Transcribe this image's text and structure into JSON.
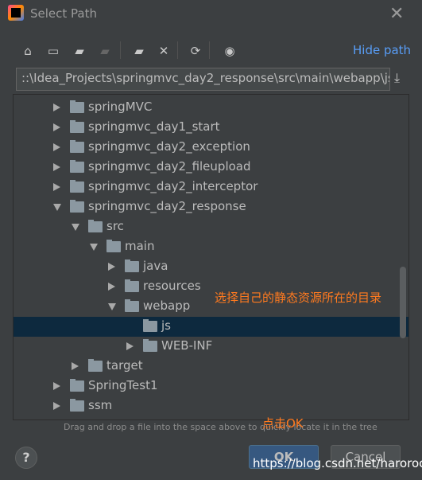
{
  "window": {
    "title": "Select Path",
    "close_icon": "close-icon"
  },
  "toolbar": {
    "icons": [
      "home-icon",
      "desktop-icon",
      "project-folder-icon",
      "module-folder-icon",
      "new-folder-icon",
      "delete-icon",
      "refresh-icon",
      "show-hidden-icon"
    ],
    "hide_path": "Hide path"
  },
  "path": {
    "value": "::\\Idea_Projects\\springmvc_day2_response\\src\\main\\webapp\\js"
  },
  "tree": {
    "rows": [
      {
        "label": "springMVC",
        "level": 0,
        "state": "collapsed"
      },
      {
        "label": "springmvc_day1_start",
        "level": 0,
        "state": "collapsed"
      },
      {
        "label": "springmvc_day2_exception",
        "level": 0,
        "state": "collapsed"
      },
      {
        "label": "springmvc_day2_fileupload",
        "level": 0,
        "state": "collapsed"
      },
      {
        "label": "springmvc_day2_interceptor",
        "level": 0,
        "state": "collapsed"
      },
      {
        "label": "springmvc_day2_response",
        "level": 0,
        "state": "expanded"
      },
      {
        "label": "src",
        "level": 1,
        "state": "expanded"
      },
      {
        "label": "main",
        "level": 2,
        "state": "expanded"
      },
      {
        "label": "java",
        "level": 3,
        "state": "collapsed"
      },
      {
        "label": "resources",
        "level": 3,
        "state": "collapsed"
      },
      {
        "label": "webapp",
        "level": 3,
        "state": "expanded"
      },
      {
        "label": "js",
        "level": 4,
        "state": "leaf",
        "selected": true
      },
      {
        "label": "WEB-INF",
        "level": 4,
        "state": "collapsed"
      },
      {
        "label": "target",
        "level": 1,
        "state": "collapsed"
      },
      {
        "label": "SpringTest1",
        "level": 0,
        "state": "collapsed"
      },
      {
        "label": "ssm",
        "level": 0,
        "state": "collapsed"
      }
    ]
  },
  "annotations": {
    "select_dir": "选择自己的静态资源所在的目录",
    "click_ok": "点击OK"
  },
  "hint": "Drag and drop a file into the space above to quickly locate it in the tree",
  "buttons": {
    "help": "?",
    "ok": "OK",
    "cancel": "Cancel"
  },
  "watermark": "https://blog.csdn.net/haroroc",
  "colors": {
    "accent": "#589df6",
    "selection": "#0d293e",
    "annotation": "#ff7a1f",
    "ok_button": "#365880"
  }
}
